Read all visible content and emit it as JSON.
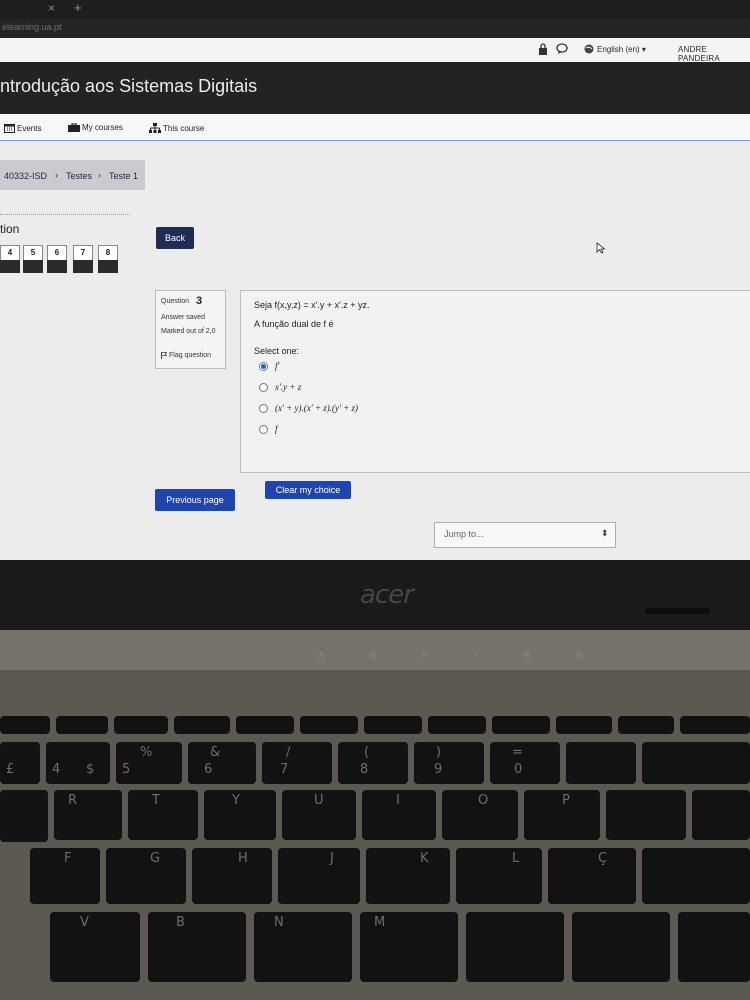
{
  "browser": {
    "tab_close": "×",
    "tab_new": "+",
    "url": "elearning.ua.pt"
  },
  "topnav": {
    "language": "English (en) ▾",
    "user": "ANDRE PANDEIRA"
  },
  "header": {
    "title": "ntrodução aos Sistemas Digitais"
  },
  "navbar": {
    "events": "Events",
    "my_courses": "My courses",
    "this_course": "This course"
  },
  "breadcrumb": {
    "course": "40332-ISD",
    "section": "Testes",
    "page": "Teste 1"
  },
  "quiz_nav": {
    "title": "tion",
    "questions": [
      "4",
      "5",
      "6",
      "7",
      "8"
    ]
  },
  "back_button": "Back",
  "question_info": {
    "label": "Question",
    "number": "3",
    "state": "Answer saved",
    "grade": "Marked out of 2,0",
    "flag": "Flag question"
  },
  "question": {
    "text": "Seja f(x,y,z) = x'.y + x'.z + yz.",
    "subtext": "A função dual de f é",
    "prompt": "Select one:",
    "options": [
      {
        "text": "f'",
        "selected": true
      },
      {
        "text": "x'.y + z",
        "selected": false
      },
      {
        "text": "(x' + y).(x' + z).(y' + z)",
        "selected": false
      },
      {
        "text": "f",
        "selected": false
      }
    ],
    "clear_label": "Clear my choice"
  },
  "previous_page": "Previous page",
  "jump": {
    "placeholder": "Jump to...",
    "arrow": "⬍"
  },
  "laptop": {
    "brand": "acer",
    "model": "A S P I R E",
    "keys": [
      [
        "£",
        "4",
        "$",
        "%",
        "5",
        "&",
        "6",
        "/",
        "7",
        "(",
        "8",
        ")",
        "9",
        "=",
        "0"
      ],
      [
        "R",
        "T",
        "Y",
        "U",
        "I",
        "O",
        "P"
      ],
      [
        "F",
        "G",
        "H",
        "J",
        "K",
        "L",
        "Ç"
      ],
      [
        "V",
        "B",
        "N",
        "M"
      ]
    ]
  },
  "colors": {
    "header_bg": "#232323",
    "primary_button": "#1f45b0",
    "back_button": "#1f2c55",
    "page_bg": "#ececec"
  }
}
